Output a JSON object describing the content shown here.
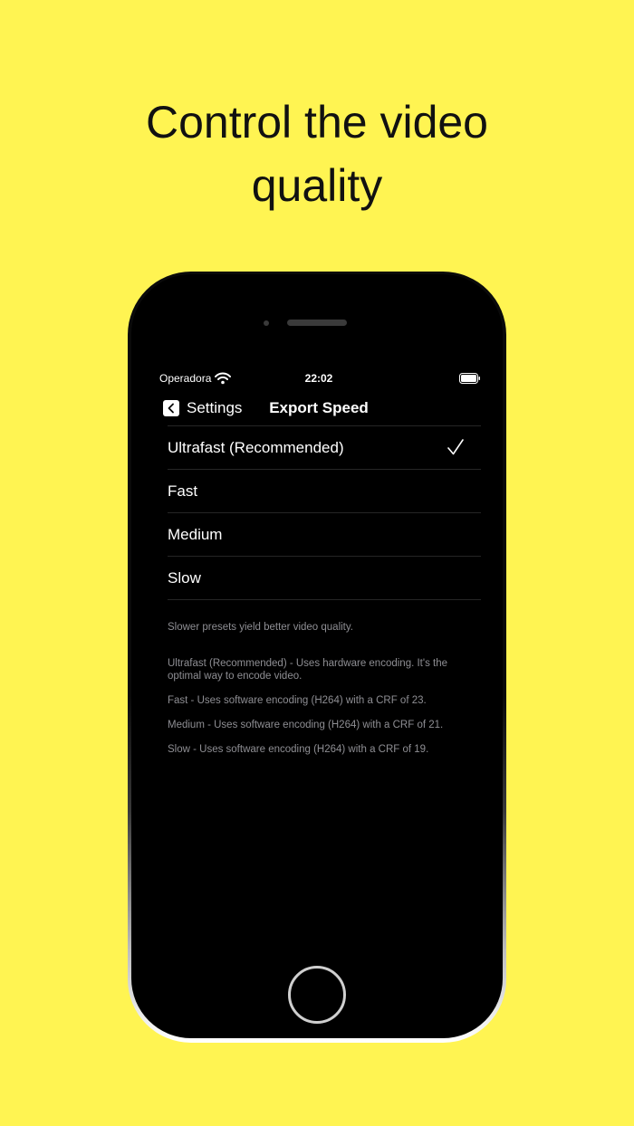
{
  "headline": {
    "line1": "Control the video",
    "line2": "quality"
  },
  "status_bar": {
    "carrier": "Operadora",
    "time": "22:02"
  },
  "nav": {
    "back_label": "Settings",
    "title": "Export Speed"
  },
  "options": [
    {
      "label": "Ultrafast (Recommended)",
      "selected": true
    },
    {
      "label": "Fast",
      "selected": false
    },
    {
      "label": "Medium",
      "selected": false
    },
    {
      "label": "Slow",
      "selected": false
    }
  ],
  "footer": {
    "summary": "Slower presets yield better video quality.",
    "descriptions": [
      "Ultrafast (Recommended) - Uses hardware encoding. It's the optimal way to encode video.",
      "Fast - Uses software encoding (H264) with a CRF of 23.",
      "Medium - Uses software encoding (H264) with a CRF of 21.",
      "Slow - Uses software encoding (H264) with a CRF of 19."
    ]
  },
  "colors": {
    "background": "#FFF452",
    "screen": "#000000",
    "text": "#FFFFFF",
    "secondary_text": "#8E8E93"
  },
  "icons": {
    "wifi": "wifi-icon",
    "battery": "battery-icon",
    "back": "chevron-left-icon",
    "check": "checkmark-icon"
  }
}
